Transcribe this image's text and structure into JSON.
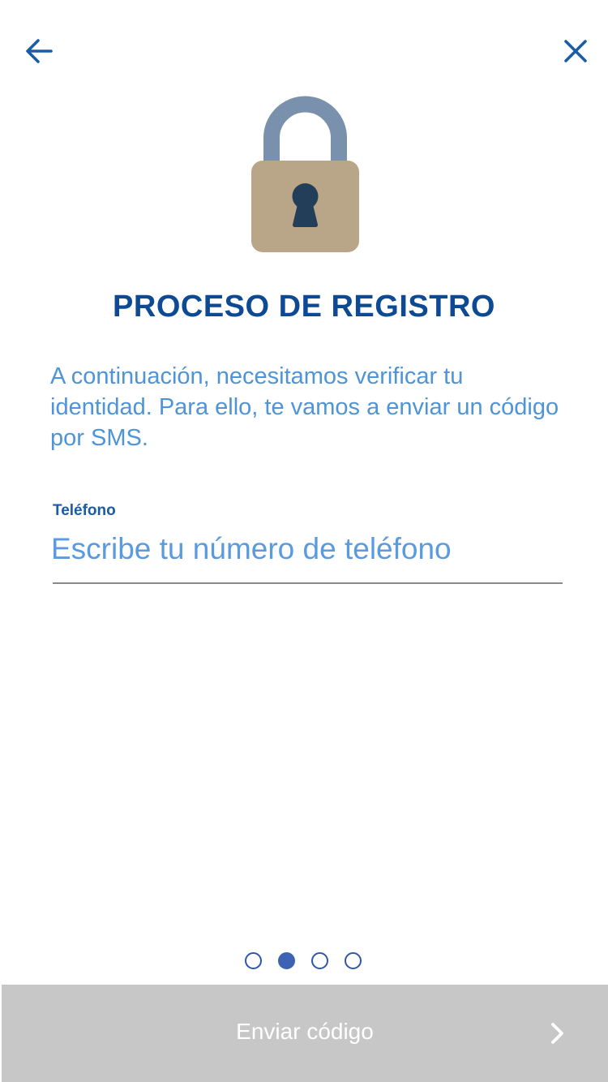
{
  "header": {
    "back_icon": "arrow-left-icon",
    "close_icon": "close-icon"
  },
  "hero": {
    "icon": "padlock-icon"
  },
  "title": "PROCESO DE REGISTRO",
  "intro_text": "A continuación, necesitamos verificar tu identidad. Para ello, te vamos a enviar un código por SMS.",
  "phone_field": {
    "label": "Teléfono",
    "value": "",
    "placeholder": "Escribe tu número de teléfono"
  },
  "pager": {
    "total": 4,
    "current": 2
  },
  "footer": {
    "send_label": "Enviar código",
    "chevron_icon": "chevron-right-icon"
  },
  "colors": {
    "brand_blue": "#0e4a94",
    "text_light_blue": "#4f94d6",
    "button_disabled": "#c7c7c7",
    "lock_shackle": "#7a91ad",
    "lock_body": "#b9a688",
    "keyhole": "#233e59"
  }
}
